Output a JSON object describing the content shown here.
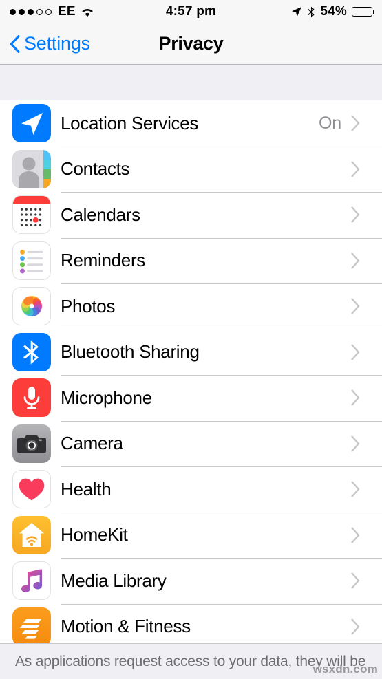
{
  "status_bar": {
    "signal_dots_filled": 3,
    "signal_dots_total": 5,
    "carrier": "EE",
    "wifi_icon": "wifi-icon",
    "time": "4:57 pm",
    "location_icon": "location-arrow-icon",
    "bluetooth_icon": "bluetooth-icon",
    "battery_percent": "54%",
    "battery_level": 54
  },
  "nav": {
    "back_label": "Settings",
    "back_icon": "chevron-left-icon",
    "title": "Privacy"
  },
  "list": {
    "rows": [
      {
        "label": "Location Services",
        "value": "On",
        "icon": "location-services-icon",
        "icon_class": "ic-location"
      },
      {
        "label": "Contacts",
        "value": "",
        "icon": "contacts-icon",
        "icon_class": "ic-contacts"
      },
      {
        "label": "Calendars",
        "value": "",
        "icon": "calendars-icon",
        "icon_class": "ic-calendars"
      },
      {
        "label": "Reminders",
        "value": "",
        "icon": "reminders-icon",
        "icon_class": "ic-reminders"
      },
      {
        "label": "Photos",
        "value": "",
        "icon": "photos-icon",
        "icon_class": "ic-photos"
      },
      {
        "label": "Bluetooth Sharing",
        "value": "",
        "icon": "bluetooth-sharing-icon",
        "icon_class": "ic-bluetooth"
      },
      {
        "label": "Microphone",
        "value": "",
        "icon": "microphone-icon",
        "icon_class": "ic-microphone"
      },
      {
        "label": "Camera",
        "value": "",
        "icon": "camera-icon",
        "icon_class": "ic-camera"
      },
      {
        "label": "Health",
        "value": "",
        "icon": "health-icon",
        "icon_class": "ic-health"
      },
      {
        "label": "HomeKit",
        "value": "",
        "icon": "homekit-icon",
        "icon_class": "ic-homekit"
      },
      {
        "label": "Media Library",
        "value": "",
        "icon": "media-library-icon",
        "icon_class": "ic-medialibrary"
      },
      {
        "label": "Motion & Fitness",
        "value": "",
        "icon": "motion-fitness-icon",
        "icon_class": "ic-motion"
      }
    ],
    "chevron_icon": "chevron-right-icon"
  },
  "footer": {
    "text": "As applications request access to your data, they will be",
    "watermark": "wsxdn.com"
  },
  "colors": {
    "accent_blue": "#007aff",
    "value_gray": "#8e8e93",
    "separator": "#c8c7cc",
    "group_bg": "#efeff4",
    "bar_bg": "#f7f7f7"
  }
}
